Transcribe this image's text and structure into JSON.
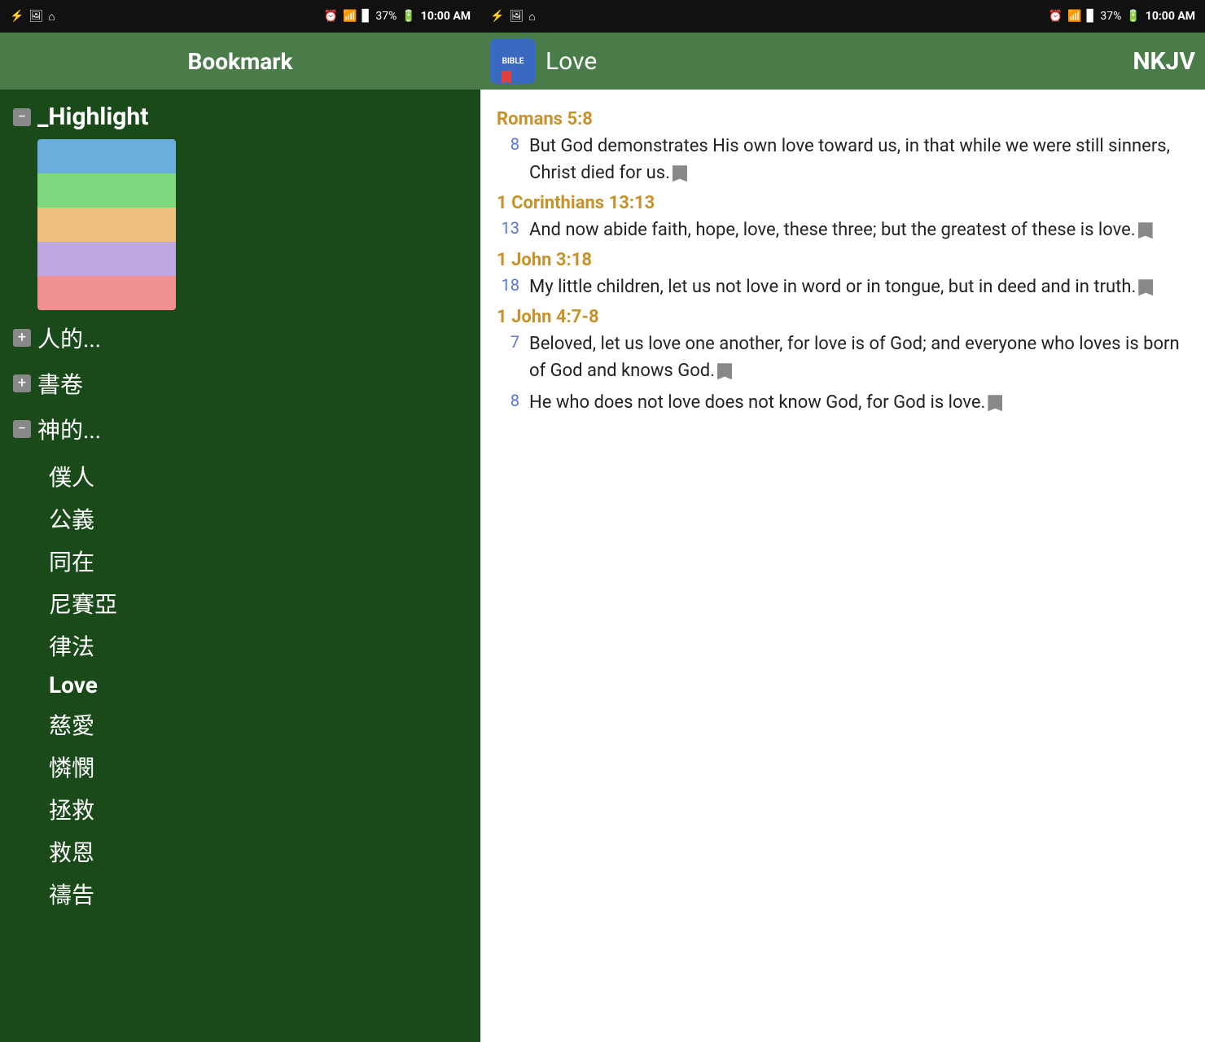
{
  "left": {
    "statusBar": {
      "icons": [
        "usb-icon",
        "image-icon",
        "home-icon",
        "alarm-icon",
        "wifi-icon",
        "signal-icon",
        "battery-icon"
      ],
      "time": "10:00 AM",
      "battery": "37%"
    },
    "header": {
      "title": "Bookmark"
    },
    "highlight": {
      "label": "_Highlight",
      "colors": [
        "#6aaedc",
        "#7dd87d",
        "#f0c080",
        "#c0a8e0",
        "#f09090"
      ]
    },
    "categories": [
      {
        "id": "ren",
        "label": "人的...",
        "expanded": false
      },
      {
        "id": "shu",
        "label": "書卷",
        "expanded": false
      },
      {
        "id": "shen",
        "label": "神的...",
        "expanded": true
      }
    ],
    "subItems": [
      "僕人",
      "公義",
      "同在",
      "尼賽亞",
      "律法",
      "Love",
      "慈愛",
      "憐憫",
      "拯救",
      "救恩",
      "禱告"
    ],
    "activeSubItem": "Love"
  },
  "right": {
    "statusBar": {
      "time": "10:00 AM",
      "battery": "37%"
    },
    "header": {
      "title": "Love",
      "version": "NKJV"
    },
    "verses": [
      {
        "reference": "Romans 5:8",
        "entries": [
          {
            "num": "8",
            "text": "But God demonstrates His own love toward us, in that while we were still sinners, Christ died for us."
          }
        ]
      },
      {
        "reference": "1 Corinthians 13:13",
        "entries": [
          {
            "num": "13",
            "text": "And now abide faith, hope, love, these three; but the greatest of these is love."
          }
        ]
      },
      {
        "reference": "1 John 3:18",
        "entries": [
          {
            "num": "18",
            "text": "My little children, let us not love in word or in tongue, but in deed and in truth."
          }
        ]
      },
      {
        "reference": "1 John 4:7-8",
        "entries": [
          {
            "num": "7",
            "text": "Beloved, let us love one another, for love is of God; and everyone who loves is born of God and knows God."
          },
          {
            "num": "8",
            "text": "He who does not love does not know God, for God is love."
          }
        ]
      }
    ]
  }
}
